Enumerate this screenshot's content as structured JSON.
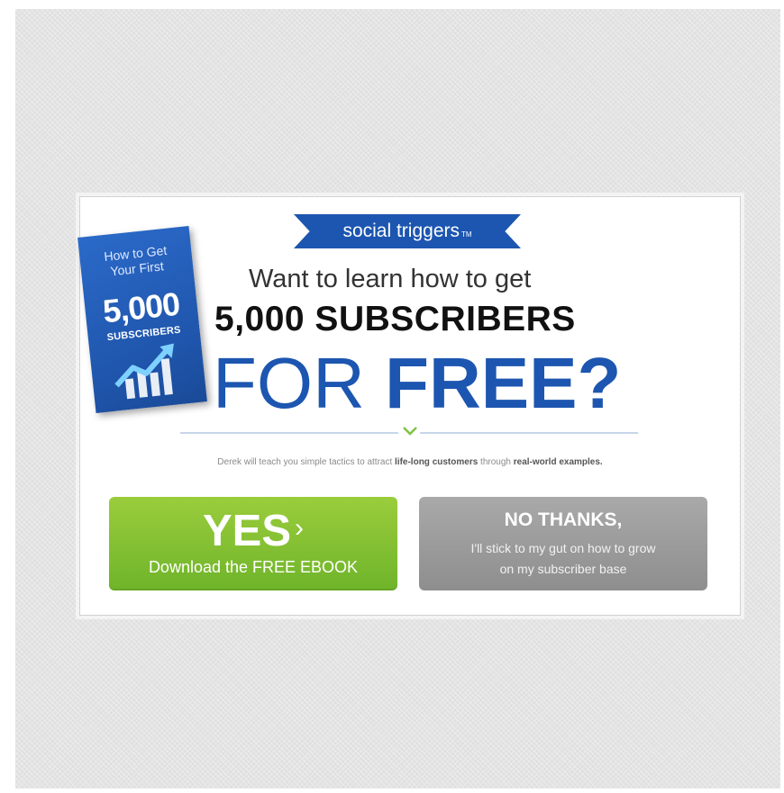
{
  "colors": {
    "brand_blue": "#1c56b0",
    "yes_green": "#7cc02f",
    "no_gray": "#9b9b9b",
    "background": "#e4e4e4"
  },
  "banner": {
    "text": "social triggers",
    "mark": "TM"
  },
  "book": {
    "line1": "How to Get",
    "line2": "Your First",
    "number": "5,000",
    "label": "SUBSCRIBERS",
    "icon": "growth-chart-icon"
  },
  "headline": {
    "line1": "Want to learn how to get",
    "line2": "5,000 SUBSCRIBERS",
    "line3_light": "FOR",
    "line3_bold": "FREE?"
  },
  "tagline": {
    "part1": "Derek will teach you simple tactics to attract ",
    "bold1": "life-long customers",
    "part2": " through ",
    "bold2": "real-world examples."
  },
  "yes_button": {
    "main": "YES",
    "arrow": "›",
    "sub": "Download the FREE EBOOK"
  },
  "no_button": {
    "main": "NO THANKS,",
    "sub_line1": "I'll stick to my gut on how to grow",
    "sub_line2": "on my subscriber base"
  }
}
